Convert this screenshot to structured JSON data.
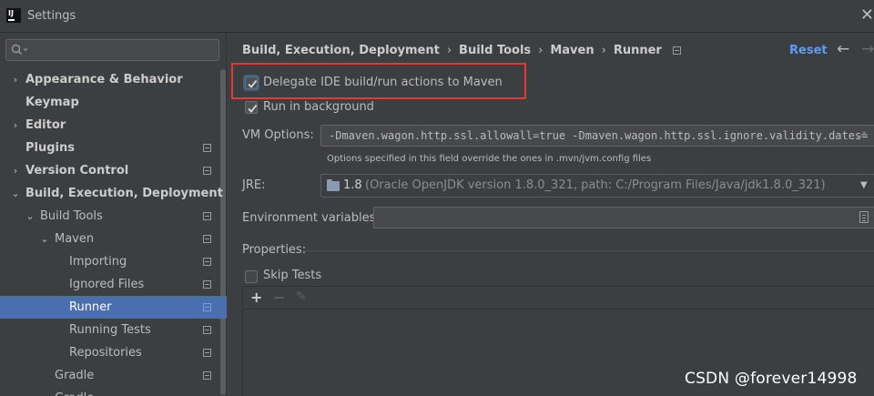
{
  "window": {
    "title": "Settings",
    "logo_text": "IJ"
  },
  "search": {
    "placeholder": "",
    "value": ""
  },
  "sidebar": {
    "items": [
      {
        "label": "Appearance & Behavior",
        "arrow": "›"
      },
      {
        "label": "Keymap"
      },
      {
        "label": "Editor",
        "arrow": "›"
      },
      {
        "label": "Plugins"
      },
      {
        "label": "Version Control",
        "arrow": "›"
      },
      {
        "label": "Build, Execution, Deployment",
        "arrow": "⌄"
      },
      {
        "label": "Build Tools",
        "arrow": "⌄"
      },
      {
        "label": "Maven",
        "arrow": "⌄"
      },
      {
        "label": "Importing"
      },
      {
        "label": "Ignored Files"
      },
      {
        "label": "Runner",
        "selected": true
      },
      {
        "label": "Running Tests"
      },
      {
        "label": "Repositories"
      },
      {
        "label": "Gradle"
      },
      {
        "label": "Gradle"
      }
    ]
  },
  "breadcrumb": {
    "items": [
      "Build, Execution, Deployment",
      "Build Tools",
      "Maven",
      "Runner"
    ],
    "separator": "›"
  },
  "header": {
    "reset_label": "Reset",
    "back_arrow": "←",
    "forward_arrow": "→"
  },
  "runner": {
    "delegate_label": "Delegate IDE build/run actions to Maven",
    "delegate_checked": true,
    "background_label": "Run in background",
    "background_checked": true,
    "vm_options_label": "VM Options:",
    "vm_options_value": "-Dmaven.wagon.http.ssl.allowall=true -Dmaven.wagon.http.ssl.ignore.validity.dates=",
    "vm_options_hint": "Options specified in this field override the ones in .mvn/jvm.config files",
    "jre_label": "JRE:",
    "jre_version": "1.8",
    "jre_detail": "(Oracle OpenJDK version 1.8.0_321, path: C:/Program Files/Java/jdk1.8.0_321)",
    "env_label": "Environment variables:",
    "env_value": "",
    "properties_label": "Properties:",
    "skip_tests_label": "Skip Tests",
    "skip_tests_checked": false
  },
  "toolbar": {
    "add_symbol": "+",
    "remove_symbol": "−",
    "edit_symbol": "✎"
  },
  "watermark": "CSDN @forever14998",
  "colors": {
    "accent": "#4b6eaf",
    "link": "#589df6",
    "highlight_border": "#e53935",
    "background": "#3c3f41"
  }
}
